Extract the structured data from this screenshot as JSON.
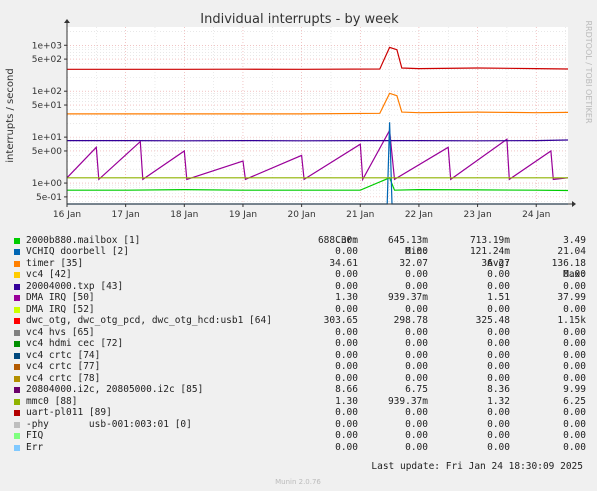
{
  "chart_data": {
    "type": "line",
    "title": "Individual interrupts - by week",
    "ylabel": "interrupts / second",
    "yscale": "log",
    "ylim": [
      0.35,
      2500
    ],
    "xlim": [
      "2025-01-16",
      "2025-01-24T13:00"
    ],
    "grid": true,
    "y_ticks": [
      {
        "value": 0.5,
        "label": "5e-01"
      },
      {
        "value": 1,
        "label": "1e+00"
      },
      {
        "value": 5,
        "label": "5e+00"
      },
      {
        "value": 10,
        "label": "1e+01"
      },
      {
        "value": 50,
        "label": "5e+01"
      },
      {
        "value": 100,
        "label": "1e+02"
      },
      {
        "value": 500,
        "label": "5e+02"
      },
      {
        "value": 1000,
        "label": "1e+03"
      }
    ],
    "x_ticks": [
      {
        "value": "2025-01-16",
        "label": "16 Jan"
      },
      {
        "value": "2025-01-17",
        "label": "17 Jan"
      },
      {
        "value": "2025-01-18",
        "label": "18 Jan"
      },
      {
        "value": "2025-01-19",
        "label": "19 Jan"
      },
      {
        "value": "2025-01-20",
        "label": "20 Jan"
      },
      {
        "value": "2025-01-21",
        "label": "21 Jan"
      },
      {
        "value": "2025-01-22",
        "label": "22 Jan"
      },
      {
        "value": "2025-01-23",
        "label": "23 Jan"
      },
      {
        "value": "2025-01-24",
        "label": "24 Jan"
      }
    ],
    "series": [
      {
        "name": "dwc_otg, dwc_otg_pcd, dwc_otg_hcd:usb1 [64]",
        "color": "#cc0000",
        "values": [
          [
            "2025-01-16",
            300
          ],
          [
            "2025-01-17",
            300
          ],
          [
            "2025-01-18",
            300
          ],
          [
            "2025-01-19",
            302
          ],
          [
            "2025-01-20",
            300
          ],
          [
            "2025-01-21T08:00",
            305
          ],
          [
            "2025-01-21T12:00",
            900
          ],
          [
            "2025-01-21T15:00",
            800
          ],
          [
            "2025-01-21T17:00",
            320
          ],
          [
            "2025-01-22",
            310
          ],
          [
            "2025-01-23",
            320
          ],
          [
            "2025-01-24",
            310
          ],
          [
            "2025-01-24T13:00",
            305
          ]
        ]
      },
      {
        "name": "timer [35]",
        "color": "#ff7d00",
        "values": [
          [
            "2025-01-16",
            32
          ],
          [
            "2025-01-17",
            32
          ],
          [
            "2025-01-18",
            32
          ],
          [
            "2025-01-19",
            32
          ],
          [
            "2025-01-20",
            32
          ],
          [
            "2025-01-21T08:00",
            33
          ],
          [
            "2025-01-21T12:00",
            90
          ],
          [
            "2025-01-21T15:00",
            80
          ],
          [
            "2025-01-21T17:00",
            35
          ],
          [
            "2025-01-22",
            34
          ],
          [
            "2025-01-23",
            35
          ],
          [
            "2025-01-24",
            34
          ],
          [
            "2025-01-24T13:00",
            34.6
          ]
        ]
      },
      {
        "name": "DMA IRQ [50]",
        "color": "#990099",
        "values": [
          [
            "2025-01-16",
            1.3
          ],
          [
            "2025-01-16T12:00",
            6
          ],
          [
            "2025-01-16T13:00",
            1.2
          ],
          [
            "2025-01-17T06:00",
            8
          ],
          [
            "2025-01-17T07:00",
            1.2
          ],
          [
            "2025-01-18T00:00",
            5
          ],
          [
            "2025-01-18T01:00",
            1.2
          ],
          [
            "2025-01-19",
            3
          ],
          [
            "2025-01-19T01:00",
            1.2
          ],
          [
            "2025-01-20",
            4
          ],
          [
            "2025-01-20T01:00",
            1.2
          ],
          [
            "2025-01-21",
            7
          ],
          [
            "2025-01-21T01:00",
            1.2
          ],
          [
            "2025-01-21T12:00",
            14
          ],
          [
            "2025-01-21T14:00",
            1.2
          ],
          [
            "2025-01-22T12:00",
            6
          ],
          [
            "2025-01-22T13:00",
            1.2
          ],
          [
            "2025-01-23T12:00",
            9
          ],
          [
            "2025-01-23T13:00",
            1.2
          ],
          [
            "2025-01-24T06:00",
            5
          ],
          [
            "2025-01-24T07:00",
            1.2
          ],
          [
            "2025-01-24T13:00",
            1.3
          ]
        ]
      },
      {
        "name": "2000b880.mailbox [1]",
        "color": "#00cc00",
        "values": [
          [
            "2025-01-16",
            0.7
          ],
          [
            "2025-01-17",
            0.7
          ],
          [
            "2025-01-18",
            0.72
          ],
          [
            "2025-01-19",
            0.7
          ],
          [
            "2025-01-20",
            0.7
          ],
          [
            "2025-01-21",
            0.7
          ],
          [
            "2025-01-21T12:00",
            1.3
          ],
          [
            "2025-01-21T14:00",
            0.7
          ],
          [
            "2025-01-22",
            0.72
          ],
          [
            "2025-01-23",
            0.71
          ],
          [
            "2025-01-24",
            0.7
          ],
          [
            "2025-01-24T13:00",
            0.69
          ]
        ]
      },
      {
        "name": "20804000.i2c, 20805000.i2c [85]",
        "color": "#330099",
        "values": [
          [
            "2025-01-16",
            8.4
          ],
          [
            "2025-01-17",
            8.4
          ],
          [
            "2025-01-18",
            8.3
          ],
          [
            "2025-01-19",
            8.4
          ],
          [
            "2025-01-20",
            8.3
          ],
          [
            "2025-01-21",
            8.4
          ],
          [
            "2025-01-22",
            8.4
          ],
          [
            "2025-01-23",
            8.3
          ],
          [
            "2025-01-24",
            8.4
          ],
          [
            "2025-01-24T13:00",
            8.66
          ]
        ]
      },
      {
        "name": "VCHIQ doorbell [2]",
        "color": "#0066b3",
        "values": [
          [
            "2025-01-16",
            0.12
          ],
          [
            "2025-01-21T11:00",
            0.12
          ],
          [
            "2025-01-21T12:00",
            21
          ],
          [
            "2025-01-21T13:00",
            0.12
          ],
          [
            "2025-01-24T13:00",
            0.12
          ]
        ]
      },
      {
        "name": "mmc0 [88]",
        "color": "#8fb300",
        "values": [
          [
            "2025-01-16",
            1.3
          ],
          [
            "2025-01-17",
            1.3
          ],
          [
            "2025-01-18",
            1.3
          ],
          [
            "2025-01-19",
            1.3
          ],
          [
            "2025-01-20",
            1.3
          ],
          [
            "2025-01-21",
            1.3
          ],
          [
            "2025-01-22",
            1.3
          ],
          [
            "2025-01-23",
            1.3
          ],
          [
            "2025-01-24",
            1.3
          ],
          [
            "2025-01-24T13:00",
            1.3
          ]
        ]
      }
    ]
  },
  "legend": {
    "headers": {
      "cur": "Cur:",
      "min": "Min:",
      "avg": "Avg:",
      "max": "Max:"
    },
    "rows": [
      {
        "color": "#00cc00",
        "name": "2000b880.mailbox [1]",
        "cur": "688.30m",
        "min": "645.13m",
        "avg": "713.19m",
        "max": "3.49"
      },
      {
        "color": "#0066b3",
        "name": "VCHIQ doorbell [2]",
        "cur": "0.00",
        "min": "0.00",
        "avg": "121.24m",
        "max": "21.04"
      },
      {
        "color": "#ff8000",
        "name": "timer [35]",
        "cur": "34.61",
        "min": "32.07",
        "avg": "36.27",
        "max": "136.18"
      },
      {
        "color": "#ffcc00",
        "name": "vc4 [42]",
        "cur": "0.00",
        "min": "0.00",
        "avg": "0.00",
        "max": "0.00"
      },
      {
        "color": "#330099",
        "name": "20004000.txp [43]",
        "cur": "0.00",
        "min": "0.00",
        "avg": "0.00",
        "max": "0.00"
      },
      {
        "color": "#990099",
        "name": "DMA IRQ [50]",
        "cur": "1.30",
        "min": "939.37m",
        "avg": "1.51",
        "max": "37.99"
      },
      {
        "color": "#ccff00",
        "name": "DMA IRQ [52]",
        "cur": "0.00",
        "min": "0.00",
        "avg": "0.00",
        "max": "0.00"
      },
      {
        "color": "#ff0000",
        "name": "dwc_otg, dwc_otg_pcd, dwc_otg_hcd:usb1 [64]",
        "cur": "303.65",
        "min": "298.78",
        "avg": "325.48",
        "max": "1.15k"
      },
      {
        "color": "#808080",
        "name": "vc4 hvs [65]",
        "cur": "0.00",
        "min": "0.00",
        "avg": "0.00",
        "max": "0.00"
      },
      {
        "color": "#008f00",
        "name": "vc4 hdmi cec [72]",
        "cur": "0.00",
        "min": "0.00",
        "avg": "0.00",
        "max": "0.00"
      },
      {
        "color": "#00487d",
        "name": "vc4 crtc [74]",
        "cur": "0.00",
        "min": "0.00",
        "avg": "0.00",
        "max": "0.00"
      },
      {
        "color": "#b35a00",
        "name": "vc4 crtc [77]",
        "cur": "0.00",
        "min": "0.00",
        "avg": "0.00",
        "max": "0.00"
      },
      {
        "color": "#b38f00",
        "name": "vc4 crtc [78]",
        "cur": "0.00",
        "min": "0.00",
        "avg": "0.00",
        "max": "0.00"
      },
      {
        "color": "#6b006b",
        "name": "20804000.i2c, 20805000.i2c [85]",
        "cur": "8.66",
        "min": "6.75",
        "avg": "8.36",
        "max": "9.99"
      },
      {
        "color": "#8fb300",
        "name": "mmc0 [88]",
        "cur": "1.30",
        "min": "939.37m",
        "avg": "1.32",
        "max": "6.25"
      },
      {
        "color": "#b30000",
        "name": "uart-pl011 [89]",
        "cur": "0.00",
        "min": "0.00",
        "avg": "0.00",
        "max": "0.00"
      },
      {
        "color": "#bebebe",
        "name": "-phy       usb-001:003:01 [0]",
        "cur": "0.00",
        "min": "0.00",
        "avg": "0.00",
        "max": "0.00"
      },
      {
        "color": "#80ff80",
        "name": "FIQ",
        "cur": "0.00",
        "min": "0.00",
        "avg": "0.00",
        "max": "0.00"
      },
      {
        "color": "#80c9ff",
        "name": "Err",
        "cur": "0.00",
        "min": "0.00",
        "avg": "0.00",
        "max": "0.00"
      }
    ]
  },
  "last_update": "Last update: Fri Jan 24 18:30:09 2025",
  "side_text": "RRDTOOL / TOBI OETIKER",
  "footer": "Munin 2.0.76",
  "colors": {
    "background": "#f0f0f0",
    "plot_bg": "#ffffff",
    "major_grid": "#e8a0a0",
    "minor_grid": "#dcdcdc",
    "axis": "#333333"
  }
}
